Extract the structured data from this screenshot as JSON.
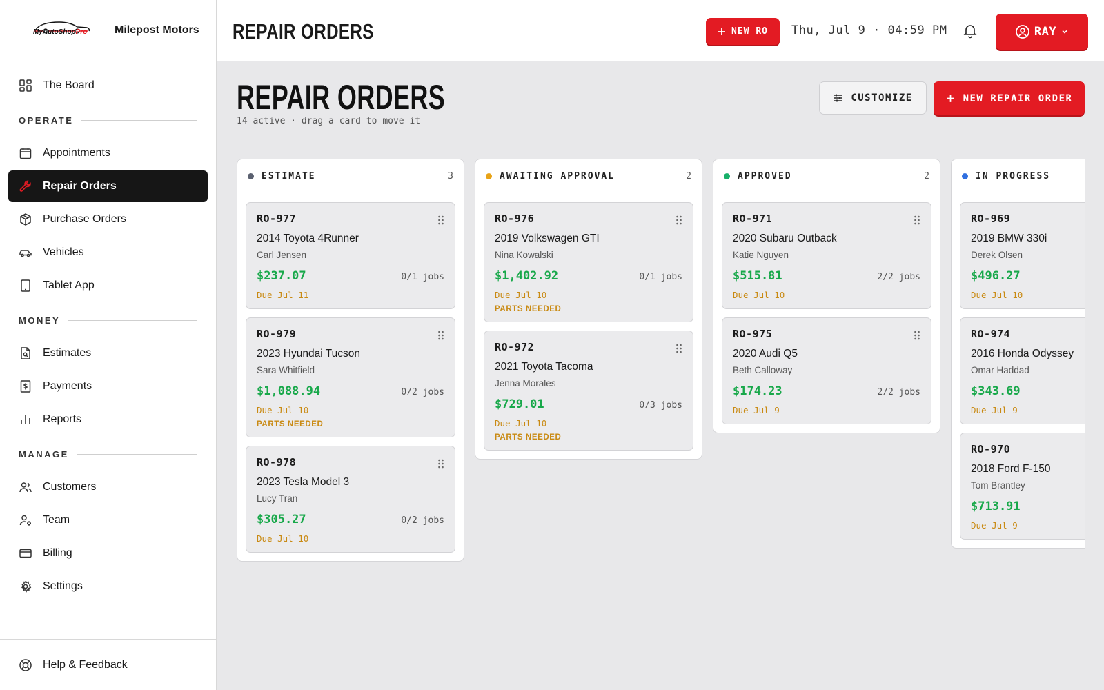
{
  "brand": {
    "logo_text_main": "MyAutoShop",
    "logo_text_accent": "Pro",
    "shop_name": "Milepost Motors"
  },
  "sidebar": {
    "top_item": {
      "label": "The Board",
      "icon": "grid-icon"
    },
    "sections": [
      {
        "title": "OPERATE",
        "items": [
          {
            "label": "Appointments",
            "icon": "calendar-icon",
            "active": false
          },
          {
            "label": "Repair Orders",
            "icon": "wrench-icon",
            "active": true
          },
          {
            "label": "Purchase Orders",
            "icon": "box-icon",
            "active": false
          },
          {
            "label": "Vehicles",
            "icon": "car-icon",
            "active": false
          },
          {
            "label": "Tablet App",
            "icon": "tablet-icon",
            "active": false
          }
        ]
      },
      {
        "title": "MONEY",
        "items": [
          {
            "label": "Estimates",
            "icon": "estimate-doc-icon"
          },
          {
            "label": "Payments",
            "icon": "dollar-doc-icon"
          },
          {
            "label": "Reports",
            "icon": "bar-chart-icon"
          }
        ]
      },
      {
        "title": "MANAGE",
        "items": [
          {
            "label": "Customers",
            "icon": "users-icon"
          },
          {
            "label": "Team",
            "icon": "user-gear-icon"
          },
          {
            "label": "Billing",
            "icon": "credit-card-icon"
          },
          {
            "label": "Settings",
            "icon": "gear-icon"
          }
        ]
      }
    ],
    "help": {
      "label": "Help & Feedback",
      "icon": "lifebuoy-icon"
    }
  },
  "topbar": {
    "title": "REPAIR ORDERS",
    "new_ro_label": "NEW RO",
    "datetime": "Thu, Jul 9 · 04:59 PM",
    "user_name": "RAY"
  },
  "main": {
    "title": "REPAIR ORDERS",
    "subtitle": "14 active · drag a card to move it",
    "customize_label": "CUSTOMIZE",
    "new_repair_order_label": "NEW REPAIR ORDER"
  },
  "colors": {
    "accent": "#e31b23",
    "amount_green": "#18a84a",
    "due_amber": "#c98a13",
    "estimate_dot": "#5b6170",
    "awaiting_dot": "#e8a317",
    "approved_dot": "#18b06a",
    "in_progress_dot": "#2f6fe0"
  },
  "board": {
    "columns": [
      {
        "name": "ESTIMATE",
        "count": "3",
        "dot_color": "#5b6170",
        "cards": [
          {
            "id": "RO-977",
            "vehicle": "2014 Toyota 4Runner",
            "customer": "Carl Jensen",
            "amount": "$237.07",
            "jobs": "0/1 jobs",
            "due": "Due Jul 11",
            "flag": ""
          },
          {
            "id": "RO-979",
            "vehicle": "2023 Hyundai Tucson",
            "customer": "Sara Whitfield",
            "amount": "$1,088.94",
            "jobs": "0/2 jobs",
            "due": "Due Jul 10",
            "flag": "PARTS NEEDED"
          },
          {
            "id": "RO-978",
            "vehicle": "2023 Tesla Model 3",
            "customer": "Lucy Tran",
            "amount": "$305.27",
            "jobs": "0/2 jobs",
            "due": "Due Jul 10",
            "flag": ""
          }
        ]
      },
      {
        "name": "AWAITING APPROVAL",
        "count": "2",
        "dot_color": "#e8a317",
        "cards": [
          {
            "id": "RO-976",
            "vehicle": "2019 Volkswagen GTI",
            "customer": "Nina Kowalski",
            "amount": "$1,402.92",
            "jobs": "0/1 jobs",
            "due": "Due Jul 10",
            "flag": "PARTS NEEDED"
          },
          {
            "id": "RO-972",
            "vehicle": "2021 Toyota Tacoma",
            "customer": "Jenna Morales",
            "amount": "$729.01",
            "jobs": "0/3 jobs",
            "due": "Due Jul 10",
            "flag": "PARTS NEEDED"
          }
        ]
      },
      {
        "name": "APPROVED",
        "count": "2",
        "dot_color": "#18b06a",
        "cards": [
          {
            "id": "RO-971",
            "vehicle": "2020 Subaru Outback",
            "customer": "Katie Nguyen",
            "amount": "$515.81",
            "jobs": "2/2 jobs",
            "due": "Due Jul 10",
            "flag": ""
          },
          {
            "id": "RO-975",
            "vehicle": "2020 Audi Q5",
            "customer": "Beth Calloway",
            "amount": "$174.23",
            "jobs": "2/2 jobs",
            "due": "Due Jul 9",
            "flag": ""
          }
        ]
      },
      {
        "name": "IN PROGRESS",
        "count": "",
        "dot_color": "#2f6fe0",
        "cards": [
          {
            "id": "RO-969",
            "vehicle": "2019 BMW 330i",
            "customer": "Derek Olsen",
            "amount": "$496.27",
            "jobs": "",
            "due": "Due Jul 10",
            "flag": ""
          },
          {
            "id": "RO-974",
            "vehicle": "2016 Honda Odyssey",
            "customer": "Omar Haddad",
            "amount": "$343.69",
            "jobs": "",
            "due": "Due Jul 9",
            "flag": ""
          },
          {
            "id": "RO-970",
            "vehicle": "2018 Ford F-150",
            "customer": "Tom Brantley",
            "amount": "$713.91",
            "jobs": "",
            "due": "Due Jul 9",
            "flag": ""
          }
        ]
      }
    ]
  }
}
